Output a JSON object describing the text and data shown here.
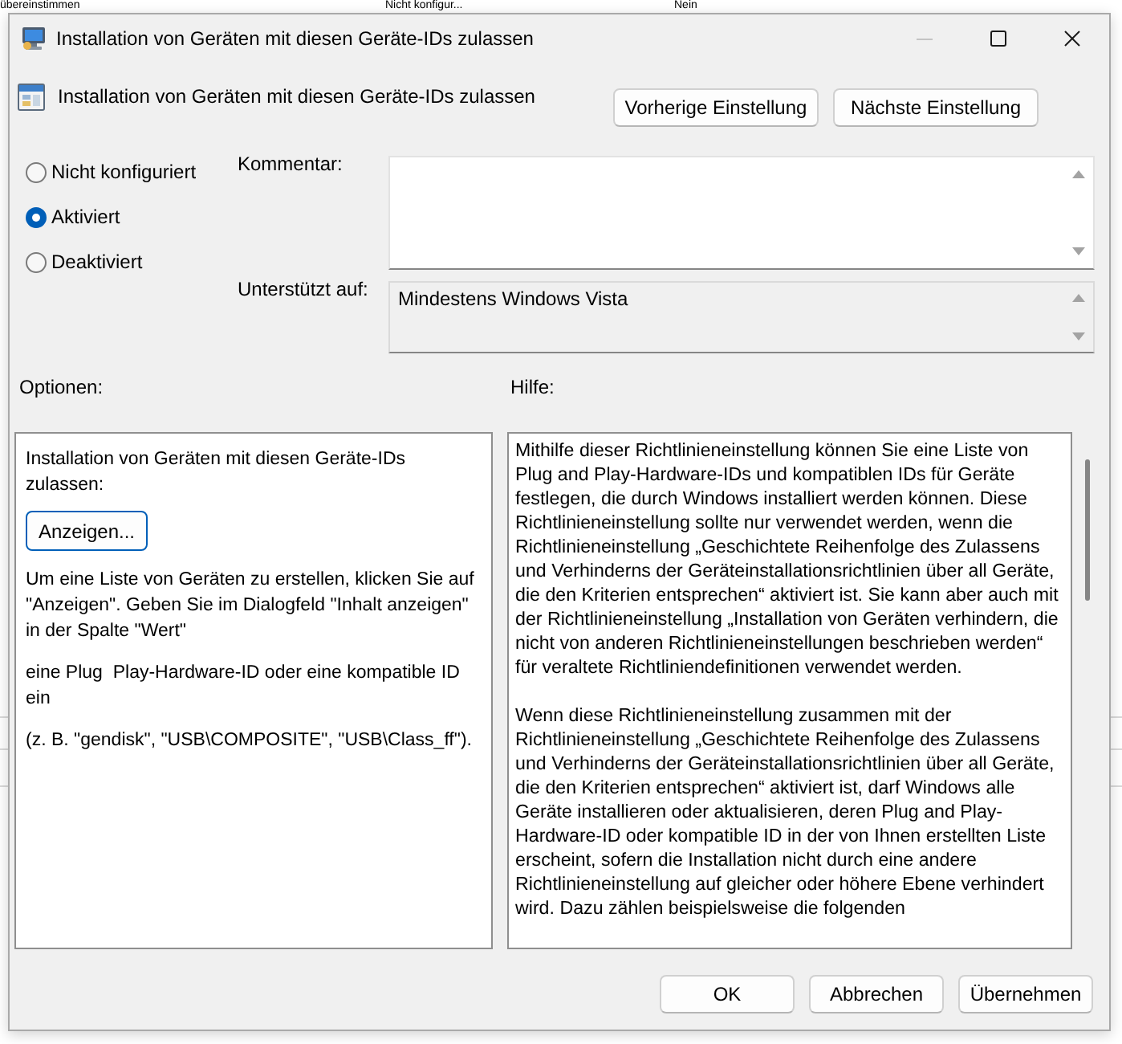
{
  "background_window": {
    "row_cells": [
      "übereinstimmen",
      "Nicht konfigur...",
      "Nein"
    ]
  },
  "window": {
    "title": "Installation von Geräten mit diesen Geräte-IDs zulassen",
    "controls": [
      {
        "kind": "minimize",
        "disabled": true
      },
      {
        "kind": "maximize",
        "disabled": false
      },
      {
        "kind": "close",
        "disabled": false
      }
    ]
  },
  "header": {
    "setting_name": "Installation von Geräten mit diesen Geräte-IDs zulassen",
    "nav_buttons": [
      "Vorherige Einstellung",
      "Nächste Einstellung"
    ]
  },
  "state_options": [
    {
      "label": "Nicht konfiguriert",
      "selected": false
    },
    {
      "label": "Aktiviert",
      "selected": true
    },
    {
      "label": "Deaktiviert",
      "selected": false
    }
  ],
  "comment": {
    "label": "Kommentar:"
  },
  "supported_on": {
    "label": "Unterstützt auf:",
    "value": "Mindestens Windows Vista"
  },
  "options": {
    "label": "Optionen:",
    "description": "Installation von Geräten mit diesen Geräte-IDs zulassen:",
    "show_button": {
      "label": "Anzeigen...",
      "focused": true
    },
    "paragraphs": [
      "Um eine Liste von Geräten zu erstellen, klicken Sie auf \"Anzeigen\". Geben Sie im Dialogfeld \"Inhalt anzeigen\" in der Spalte \"Wert\"",
      "eine Plug  Play-Hardware-ID oder eine kompatible ID ein",
      "(z. B. \"gendisk\", \"USB\\COMPOSITE\", \"USB\\Class_ff\")."
    ]
  },
  "help": {
    "label": "Hilfe:",
    "paragraphs": [
      "Mithilfe dieser Richtlinieneinstellung können Sie eine Liste von Plug and Play-Hardware-IDs und kompatiblen IDs für Geräte festlegen, die durch Windows installiert werden können. Diese Richtlinieneinstellung sollte nur verwendet werden, wenn die Richtlinieneinstellung „Geschichtete Reihenfolge des Zulassens und Verhinderns der Geräteinstallationsrichtlinien über all Geräte, die den Kriterien entsprechen“ aktiviert ist. Sie kann aber auch mit der Richtlinieneinstellung „Installation von Geräten verhindern, die nicht von anderen Richtlinieneinstellungen beschrieben werden“ für veraltete Richtliniendefinitionen verwendet werden.",
      "Wenn diese Richtlinieneinstellung zusammen mit der Richtlinieneinstellung „Geschichtete Reihenfolge des Zulassens und Verhinderns der Geräteinstallationsrichtlinien über all Geräte, die den Kriterien entsprechen“ aktiviert ist, darf Windows alle Geräte installieren oder aktualisieren, deren Plug and Play-Hardware-ID oder kompatible ID in der von Ihnen erstellten Liste erscheint, sofern die Installation nicht durch eine andere Richtlinieneinstellung auf gleicher oder höhere Ebene verhindert wird. Dazu zählen beispielsweise die folgenden"
    ]
  },
  "footer_buttons": [
    "OK",
    "Abbrechen",
    "Übernehmen"
  ]
}
